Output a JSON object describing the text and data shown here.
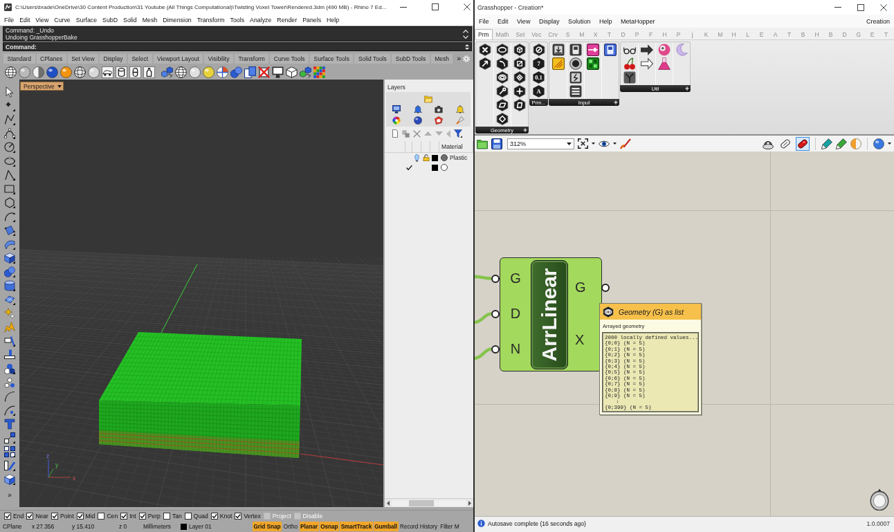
{
  "rhino": {
    "title": "C:\\Users\\brade\\OneDrive\\30 Content Production\\31 Youtube (All Things Computational)\\Twisting Voxel Tower\\Rendered.3dm (490 MB) - Rhino 7 Ed...",
    "menu": [
      "File",
      "Edit",
      "View",
      "Curve",
      "Surface",
      "SubD",
      "Solid",
      "Mesh",
      "Dimension",
      "Transform",
      "Tools",
      "Analyze",
      "Render",
      "Panels",
      "Help"
    ],
    "command_history": [
      "Command: _Undo",
      "Undoing GrasshopperBake"
    ],
    "command_prompt": "Command:",
    "toolbar_tabs": [
      "Standard",
      "CPlanes",
      "Set View",
      "Display",
      "Select",
      "Viewport Layout",
      "Visibility",
      "Transform",
      "Curve Tools",
      "Surface Tools",
      "Solid Tools",
      "SubD Tools",
      "Mesh"
    ],
    "toolbar_overflow": "»",
    "sidebar_overflow": "»",
    "viewport": {
      "title": "Perspective",
      "axis_labels": [
        "z",
        "y",
        "x"
      ]
    },
    "layers": {
      "title": "Layers",
      "columns": [
        "Material"
      ],
      "rows": [
        {
          "current": false,
          "on": true,
          "color": "#000000",
          "material": {
            "name": "Plastic",
            "color": "#6e6e6e"
          }
        },
        {
          "current": true,
          "on": false,
          "color": "#000000",
          "material": {
            "color": "#ffffff"
          }
        }
      ]
    },
    "osnaps": [
      {
        "label": "End",
        "checked": true,
        "disabled": false
      },
      {
        "label": "Near",
        "checked": true,
        "disabled": false
      },
      {
        "label": "Point",
        "checked": true,
        "disabled": false
      },
      {
        "label": "Mid",
        "checked": true,
        "disabled": false
      },
      {
        "label": "Cen",
        "checked": false,
        "disabled": false
      },
      {
        "label": "Int",
        "checked": true,
        "disabled": false
      },
      {
        "label": "Perp",
        "checked": true,
        "disabled": false
      },
      {
        "label": "Tan",
        "checked": false,
        "disabled": false
      },
      {
        "label": "Quad",
        "checked": false,
        "disabled": false
      },
      {
        "label": "Knot",
        "checked": true,
        "disabled": false
      },
      {
        "label": "Vertex",
        "checked": true,
        "disabled": false
      },
      {
        "label": "Project",
        "checked": false,
        "disabled": true
      },
      {
        "label": "Disable",
        "checked": false,
        "disabled": true
      }
    ],
    "status": [
      {
        "kind": "text",
        "text": "CPlane"
      },
      {
        "kind": "text",
        "text": "x 27.356"
      },
      {
        "kind": "text",
        "text": "y 15.410"
      },
      {
        "kind": "text",
        "text": "z 0"
      },
      {
        "kind": "text",
        "text": "Millimeters"
      },
      {
        "kind": "layer",
        "text": "Layer 01",
        "color": "#000000"
      },
      {
        "kind": "toggle",
        "text": "Grid Snap",
        "on": true
      },
      {
        "kind": "toggle",
        "text": "Ortho",
        "on": false
      },
      {
        "kind": "toggle",
        "text": "Planar",
        "on": true
      },
      {
        "kind": "toggle",
        "text": "Osnap",
        "on": true
      },
      {
        "kind": "toggle",
        "text": "SmartTrack",
        "on": true
      },
      {
        "kind": "toggle",
        "text": "Gumball",
        "on": true
      },
      {
        "kind": "toggle",
        "text": "Record History",
        "on": false
      },
      {
        "kind": "toggle",
        "text": "Filter",
        "on": false
      },
      {
        "kind": "text",
        "text": "M"
      }
    ]
  },
  "grasshopper": {
    "title": "Grasshopper - Creation*",
    "menu": [
      "File",
      "Edit",
      "View",
      "Display",
      "Solution",
      "Help",
      "MetaHopper"
    ],
    "document": "Creation",
    "tabs": [
      {
        "label": "Prm",
        "selected": true
      },
      {
        "label": "Math",
        "selected": false
      },
      {
        "label": "Set",
        "selected": false
      },
      {
        "label": "Vec",
        "selected": false
      },
      {
        "label": "Crv",
        "selected": false
      },
      {
        "label": "S",
        "selected": false
      },
      {
        "label": "M",
        "selected": false
      },
      {
        "label": "X",
        "selected": false
      },
      {
        "label": "T",
        "selected": false
      },
      {
        "label": "D",
        "selected": false
      },
      {
        "label": "P",
        "selected": false
      },
      {
        "label": "F",
        "selected": false
      },
      {
        "label": "H",
        "selected": false
      },
      {
        "label": "P",
        "selected": false
      },
      {
        "label": "j",
        "selected": false
      },
      {
        "label": "K",
        "selected": false
      },
      {
        "label": "M",
        "selected": false
      },
      {
        "label": "H",
        "selected": false
      },
      {
        "label": "L",
        "selected": false
      },
      {
        "label": "E",
        "selected": false
      },
      {
        "label": "A",
        "selected": false
      },
      {
        "label": "T",
        "selected": false
      },
      {
        "label": "B",
        "selected": false
      },
      {
        "label": "H",
        "selected": false
      },
      {
        "label": "B",
        "selected": false
      },
      {
        "label": "D",
        "selected": false
      },
      {
        "label": "G",
        "selected": false
      },
      {
        "label": "E",
        "selected": false
      },
      {
        "label": "T",
        "selected": false
      }
    ],
    "panels": [
      {
        "label": "Geometry",
        "expandable": true
      },
      {
        "label": "Prm...",
        "expandable": false,
        "glyphs": [
          "7",
          "0.1",
          "A"
        ]
      },
      {
        "label": "Input",
        "expandable": true
      },
      {
        "label": "Util",
        "expandable": true
      }
    ],
    "zoom": "312%",
    "preview_modes": [
      {
        "selected": false
      },
      {
        "selected": false
      },
      {
        "selected": true
      }
    ],
    "component": {
      "name": "ArrLinear",
      "inputs": [
        "G",
        "D",
        "N"
      ],
      "outputs": [
        "G",
        "X"
      ]
    },
    "tooltip": {
      "title": "Geometry (G) as list",
      "description": "Arrayed geometry",
      "header": "2000 locally defined values...",
      "items": [
        "{0;0} (N = 5)",
        "{0;1} (N = 5)",
        "{0;2} (N = 5)",
        "{0;3} (N = 5)",
        "{0;4} (N = 5)",
        "{0;5} (N = 5)",
        "{0;6} (N = 5)",
        "{0;7} (N = 5)",
        "{0;8} (N = 5)",
        "{0;9} (N = 5)"
      ],
      "more": "↓",
      "last": "{0;399} (N = 5)"
    },
    "status": "Autosave complete (16 seconds ago)",
    "version": "1.0.0007"
  }
}
